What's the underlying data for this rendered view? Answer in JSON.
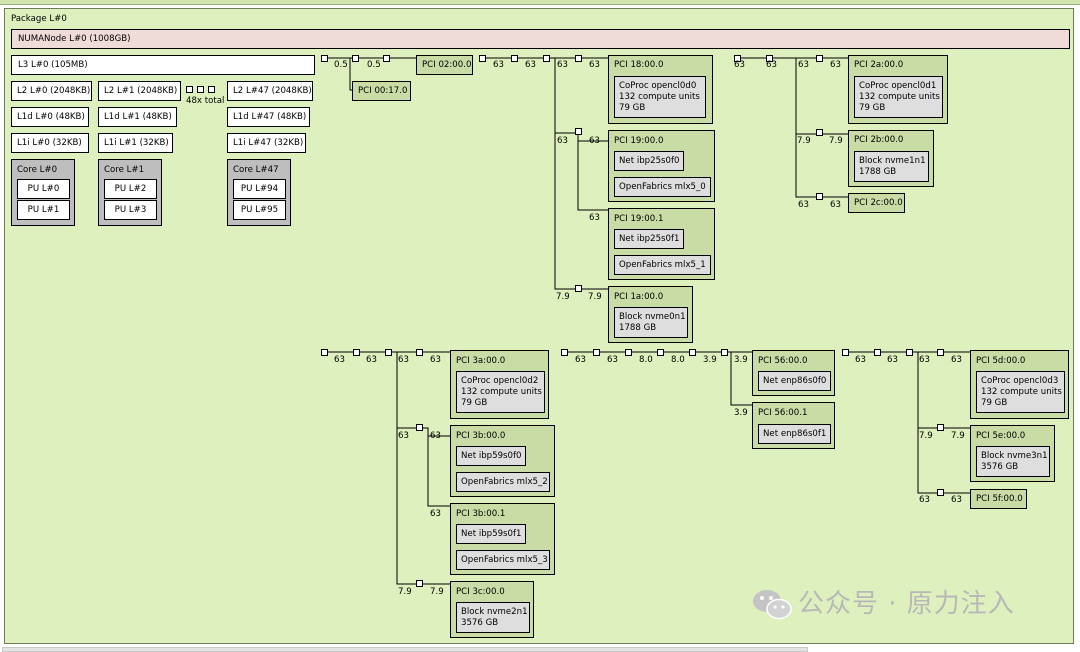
{
  "package": {
    "label": "Package L#0"
  },
  "numa": {
    "label": "NUMANode L#0 (1008GB)"
  },
  "l3": {
    "label": "L3 L#0 (105MB)"
  },
  "caches": {
    "l2_0": "L2 L#0 (2048KB)",
    "l2_1": "L2 L#1 (2048KB)",
    "l2_47": "L2 L#47 (2048KB)",
    "l1d_0": "L1d L#0 (48KB)",
    "l1d_1": "L1d L#1 (48KB)",
    "l1d_47": "L1d L#47 (48KB)",
    "l1i_0": "L1i L#0 (32KB)",
    "l1i_1": "L1i L#1 (32KB)",
    "l1i_47": "L1i L#47 (32KB)"
  },
  "collapsed": {
    "label": "48x total"
  },
  "cores": {
    "c0": {
      "label": "Core L#0",
      "pu_a": "PU L#0",
      "pu_b": "PU L#1"
    },
    "c1": {
      "label": "Core L#1",
      "pu_a": "PU L#2",
      "pu_b": "PU L#3"
    },
    "c47": {
      "label": "Core L#47",
      "pu_a": "PU L#94",
      "pu_b": "PU L#95"
    }
  },
  "pci": {
    "p02": "PCI 02:00.0",
    "p0017": "PCI 00:17.0",
    "p18": "PCI 18:00.0",
    "p19_0": "PCI 19:00.0",
    "p19_1": "PCI 19:00.1",
    "p1a": "PCI 1a:00.0",
    "p2a": "PCI 2a:00.0",
    "p2b": "PCI 2b:00.0",
    "p2c": "PCI 2c:00.0",
    "p3a": "PCI 3a:00.0",
    "p3b_0": "PCI 3b:00.0",
    "p3b_1": "PCI 3b:00.1",
    "p3c": "PCI 3c:00.0",
    "p56_0": "PCI 56:00.0",
    "p56_1": "PCI 56:00.1",
    "p5d": "PCI 5d:00.0",
    "p5e": "PCI 5e:00.0",
    "p5f": "PCI 5f:00.0"
  },
  "devices": {
    "coproc0": {
      "line1": "CoProc opencl0d0",
      "line2": "132 compute units",
      "line3": "79 GB"
    },
    "coproc1": {
      "line1": "CoProc opencl0d1",
      "line2": "132 compute units",
      "line3": "79 GB"
    },
    "coproc2": {
      "line1": "CoProc opencl0d2",
      "line2": "132 compute units",
      "line3": "79 GB"
    },
    "coproc3": {
      "line1": "CoProc opencl0d3",
      "line2": "132 compute units",
      "line3": "79 GB"
    },
    "net_ibp25s0f0": "Net ibp25s0f0",
    "of_mlx5_0": "OpenFabrics mlx5_0",
    "net_ibp25s0f1": "Net ibp25s0f1",
    "of_mlx5_1": "OpenFabrics mlx5_1",
    "nvme0n1": {
      "line1": "Block nvme0n1",
      "line2": "1788 GB"
    },
    "nvme1n1": {
      "line1": "Block nvme1n1",
      "line2": "1788 GB"
    },
    "net_ibp59s0f0": "Net ibp59s0f0",
    "of_mlx5_2": "OpenFabrics mlx5_2",
    "net_ibp59s0f1": "Net ibp59s0f1",
    "of_mlx5_3": "OpenFabrics mlx5_3",
    "nvme2n1": {
      "line1": "Block nvme2n1",
      "line2": "3576 GB"
    },
    "net_enp86s0f0": "Net enp86s0f0",
    "net_enp86s0f1": "Net enp86s0f1",
    "nvme3n1": {
      "line1": "Block nvme3n1",
      "line2": "3576 GB"
    }
  },
  "links": {
    "a1": "0.5",
    "a2": "0.5",
    "b1": "63",
    "b2": "63",
    "b3": "63",
    "b4": "63",
    "b5": "63",
    "b6": "63",
    "b7": "7.9",
    "b8": "7.9",
    "c1": "63",
    "c2": "63",
    "c3": "63",
    "c4": "63",
    "c5": "7.9",
    "c6": "7.9",
    "c7": "63",
    "c8": "63",
    "d1": "63",
    "d2": "63",
    "d3": "63",
    "d4": "63",
    "d5": "63",
    "d6": "63",
    "d7": "7.9",
    "d8": "7.9",
    "e1": "63",
    "e2": "63",
    "e3": "8.0",
    "e4": "8.0",
    "e5": "3.9",
    "e6": "3.9",
    "e7": "3.9",
    "f1": "63",
    "f2": "63",
    "f3": "63",
    "f4": "63",
    "f5": "7.9",
    "f6": "7.9",
    "f7": "63",
    "f8": "63"
  },
  "watermark": {
    "text": "公众号 · 原力注入"
  }
}
